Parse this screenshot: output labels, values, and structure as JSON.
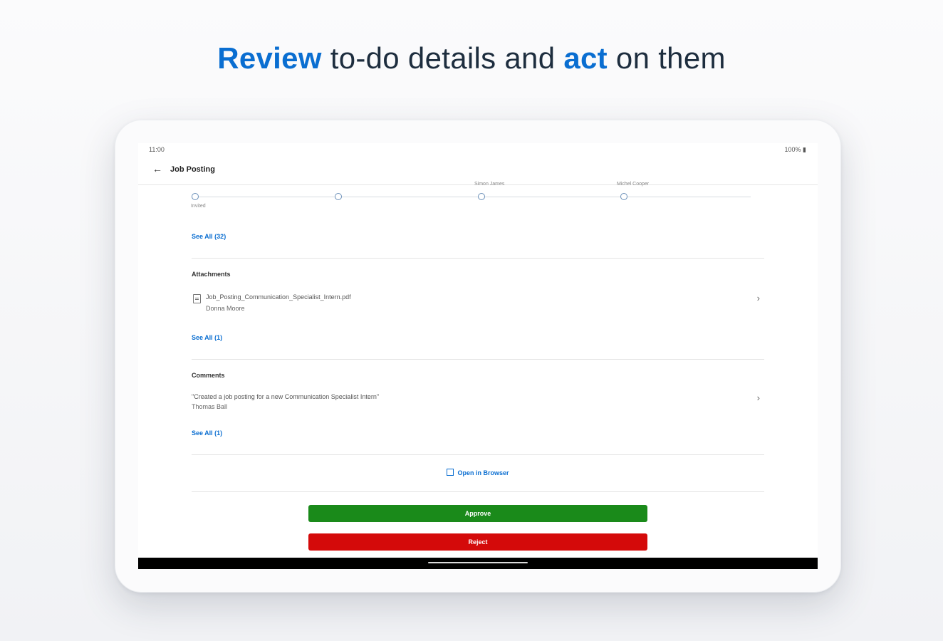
{
  "headline": {
    "part1": "Review",
    "part2": " to-do details and ",
    "part3": "act",
    "part4": " on them"
  },
  "device": {
    "status_time": "11:00",
    "status_right": "100%",
    "app_title": "Job Posting"
  },
  "timeline": {
    "nodes": [
      {
        "label_bottom": "Invited"
      },
      {
        "label_top": ""
      },
      {
        "label_top": "Simon James"
      },
      {
        "label_top": "Michel Cooper"
      }
    ]
  },
  "links": {
    "see_all_approvers": "See All (32)",
    "see_all_attachments": "See All (1)",
    "see_all_comments": "See All (1)",
    "open_in_browser": "Open in Browser"
  },
  "attachments": {
    "title": "Attachments",
    "items": [
      {
        "name": "Job_Posting_Communication_Specialist_Intern.pdf",
        "owner": "Donna Moore"
      }
    ]
  },
  "comments": {
    "title": "Comments",
    "items": [
      {
        "text": "\"Created a job posting for a new Communication Specialist Intern\"",
        "author": "Thomas Ball"
      }
    ]
  },
  "actions": {
    "approve": "Approve",
    "reject": "Reject"
  },
  "colors": {
    "accent": "#0a6ed1",
    "approve": "#1a8a1a",
    "reject": "#d40a0a"
  }
}
